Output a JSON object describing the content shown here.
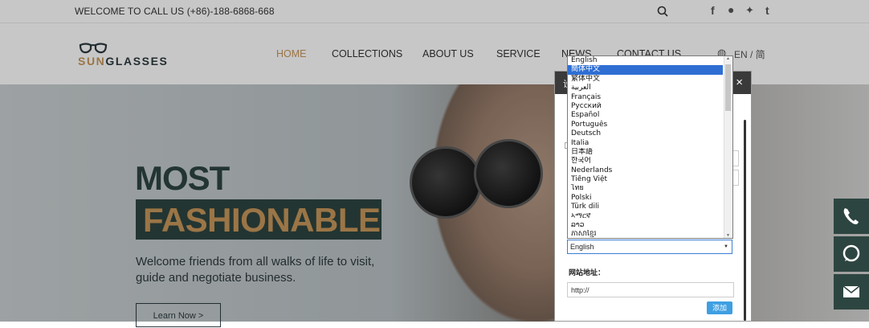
{
  "topbar": {
    "welcome": "WELCOME TO CALL US  (+86)-188-6868-668",
    "social_icons": [
      "search-icon",
      "facebook-icon",
      "skype-icon",
      "twitter-icon",
      "tumblr-icon"
    ]
  },
  "logo": {
    "prefix": "SUN",
    "suffix": "GLASSES"
  },
  "nav": {
    "items": [
      {
        "label": "HOME"
      },
      {
        "label": "COLLECTIONS"
      },
      {
        "label": "ABOUT US"
      },
      {
        "label": "SERVICE"
      },
      {
        "label": "NEWS"
      },
      {
        "label": "CONTACT US"
      }
    ],
    "lang": "EN  /  简"
  },
  "hero": {
    "line1": "MOST",
    "line2": "FASHIONABLE",
    "subtitle": "Welcome friends from all walks of life to visit, guide and negotiate business.",
    "button": "Learn Now >"
  },
  "dialog": {
    "header_char": "设",
    "close": "×",
    "select_value": "English",
    "url_label": "网站地址：",
    "url_value": "http://",
    "add_button": "添加",
    "options": [
      "English",
      "簡体中文",
      "繁体中文",
      "العربية",
      "Français",
      "Русский",
      "Español",
      "Português",
      "Deutsch",
      "Italia",
      "日本語",
      "한국어",
      "Nederlands",
      "Tiếng Việt",
      "ไทย",
      "Polski",
      "Türk dili",
      "ኣማርኛ",
      "ລາວ",
      "ភាសាខ្មែរ"
    ],
    "selected_index": 1
  },
  "colors": {
    "accent": "#c7965a",
    "dark": "#2d4540",
    "select_highlight": "#2f6fd3"
  }
}
